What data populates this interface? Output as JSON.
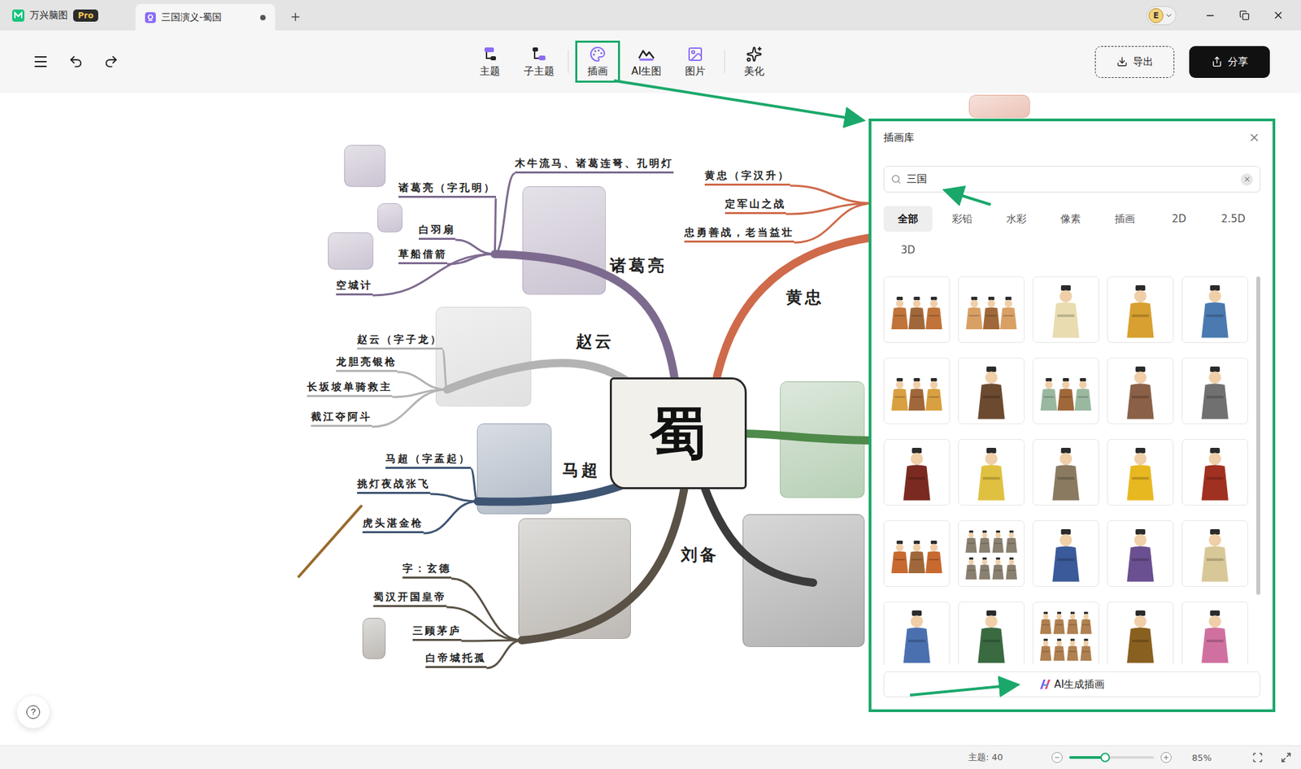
{
  "app": {
    "name": "万兴脑图",
    "badge": "Pro"
  },
  "user": {
    "initial": "E"
  },
  "tabs": [
    {
      "label": "三国演义-蜀国",
      "selected": true,
      "modified": true
    }
  ],
  "toolbar": {
    "tools": [
      {
        "label": "主题",
        "highlighted": false
      },
      {
        "label": "子主题",
        "highlighted": false
      },
      {
        "label": "插画",
        "highlighted": true
      },
      {
        "label": "AI生图",
        "highlighted": false
      },
      {
        "label": "图片",
        "highlighted": false
      },
      {
        "label": "美化",
        "highlighted": false
      }
    ],
    "export": "导出",
    "share": "分享"
  },
  "mindmap": {
    "center": "蜀",
    "branches": [
      {
        "label": "诸葛亮",
        "color": "#7d6b8f",
        "topics": [
          "诸葛亮（字孔明）",
          "木牛流马、诸葛连弩、孔明灯",
          "白羽扇",
          "草船借箭",
          "空城计"
        ]
      },
      {
        "label": "赵云",
        "color": "#b3b3b3",
        "topics": [
          "赵云（字子龙）",
          "龙胆亮银枪",
          "长坂坡单骑救主",
          "截江夺阿斗"
        ]
      },
      {
        "label": "马超",
        "color": "#3e5573",
        "topics": [
          "马超（字孟起）",
          "挑灯夜战张飞",
          "虎头湛金枪"
        ]
      },
      {
        "label": "刘备",
        "color": "#5a5246",
        "topics": [
          "字：玄德",
          "蜀汉开国皇帝",
          "三顾茅庐",
          "白帝城托孤"
        ]
      },
      {
        "label": "黄忠",
        "color": "#cf6a4a",
        "topics": [
          "黄忠（字汉升）",
          "定军山之战",
          "忠勇善战，老当益壮"
        ]
      },
      {
        "color": "#4e8a4a",
        "topics": []
      },
      {
        "color": "#3b3b3b",
        "topics": []
      }
    ]
  },
  "panel": {
    "title": "插画库",
    "search": {
      "value": "三国"
    },
    "filters": [
      {
        "label": "全部",
        "selected": true
      },
      {
        "label": "彩铅",
        "selected": false
      },
      {
        "label": "水彩",
        "selected": false
      },
      {
        "label": "像素",
        "selected": false
      },
      {
        "label": "插画",
        "selected": false
      },
      {
        "label": "2D",
        "selected": false
      },
      {
        "label": "2.5D",
        "selected": false
      },
      {
        "label": "3D",
        "selected": false
      }
    ],
    "illustrations": [
      {
        "kind": "group",
        "color": "#c0743a"
      },
      {
        "kind": "group",
        "color": "#d9a066"
      },
      {
        "kind": "single",
        "color": "#e8dcb0"
      },
      {
        "kind": "single",
        "color": "#d8a030"
      },
      {
        "kind": "single",
        "color": "#4a7ab0"
      },
      {
        "kind": "group",
        "color": "#d8a040"
      },
      {
        "kind": "single",
        "color": "#6b4a30"
      },
      {
        "kind": "group",
        "color": "#9ab8a0"
      },
      {
        "kind": "single",
        "color": "#8a6048"
      },
      {
        "kind": "single",
        "color": "#707070"
      },
      {
        "kind": "single",
        "color": "#7a2a20"
      },
      {
        "kind": "single",
        "color": "#e0c040"
      },
      {
        "kind": "single",
        "color": "#8a7a60"
      },
      {
        "kind": "single",
        "color": "#e8b820"
      },
      {
        "kind": "single",
        "color": "#a03020"
      },
      {
        "kind": "group",
        "color": "#c86a30"
      },
      {
        "kind": "sheet",
        "color": "#8a8070"
      },
      {
        "kind": "single",
        "color": "#3a5a9a"
      },
      {
        "kind": "single",
        "color": "#6a5090"
      },
      {
        "kind": "single",
        "color": "#d8c898"
      },
      {
        "kind": "single",
        "color": "#4a70b0"
      },
      {
        "kind": "single",
        "color": "#3a6a40"
      },
      {
        "kind": "sheet",
        "color": "#b08050"
      },
      {
        "kind": "single",
        "color": "#8a6020"
      },
      {
        "kind": "single",
        "color": "#d070a0"
      }
    ],
    "ai_button": "AI生成插画"
  },
  "status_bar": {
    "topics": "主题: 40",
    "zoom": {
      "level": 0.42,
      "reading": "85%"
    }
  },
  "help": "?"
}
